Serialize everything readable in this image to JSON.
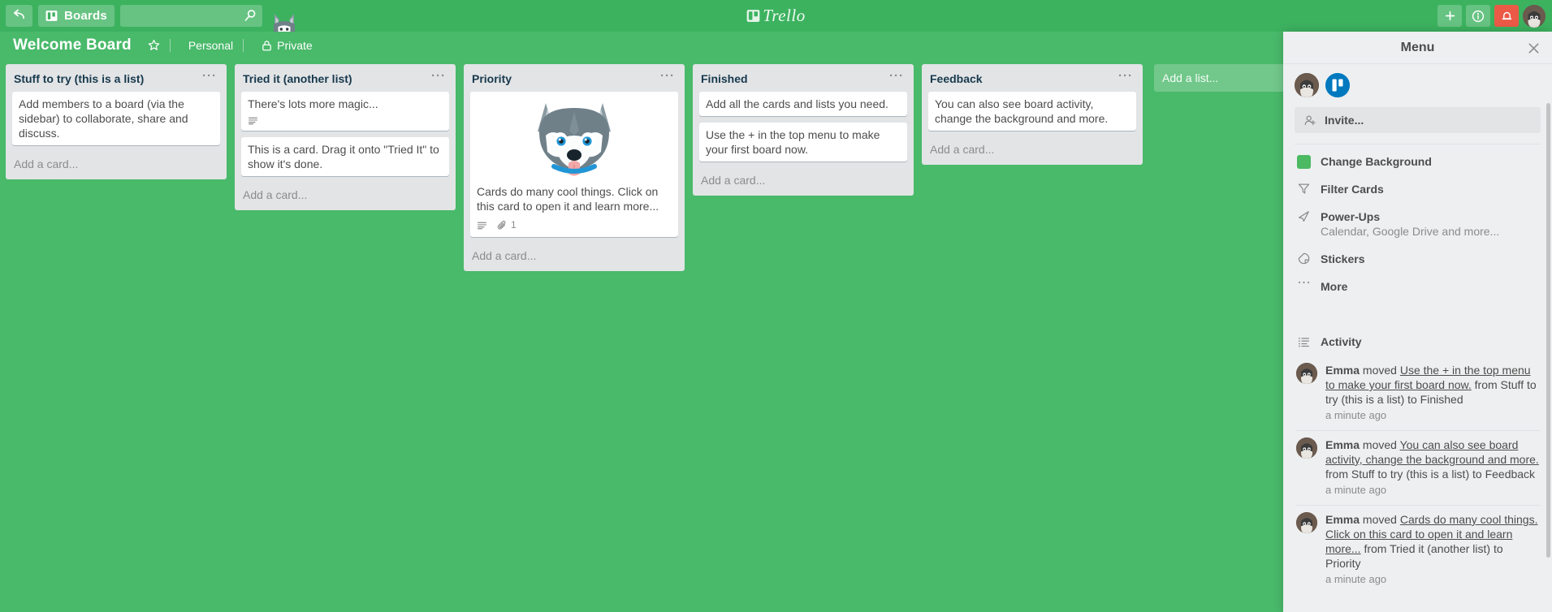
{
  "topbar": {
    "back_label": "back-arrow",
    "boards_label": "Boards",
    "search_placeholder": "",
    "search_value": "",
    "brand": "Trello",
    "add_label": "+",
    "info_label": "i",
    "notifications_label": "bell"
  },
  "board_header": {
    "title": "Welcome Board",
    "star": "☆",
    "team": "Personal",
    "visibility": "Private"
  },
  "lists": [
    {
      "title": "Stuff to try (this is a list)",
      "menu": "···",
      "add_card": "Add a card...",
      "cards": [
        {
          "text": "Add members to a board (via the sidebar) to collaborate, share and discuss.",
          "has_description": false,
          "attachments": ""
        }
      ]
    },
    {
      "title": "Tried it (another list)",
      "menu": "···",
      "add_card": "Add a card...",
      "cards": [
        {
          "text": "There's lots more magic...",
          "has_description": true,
          "attachments": ""
        },
        {
          "text": "This is a card. Drag it onto \"Tried It\" to show it's done.",
          "has_description": false,
          "attachments": ""
        }
      ]
    },
    {
      "title": "Priority",
      "menu": "···",
      "add_card": "Add a card...",
      "cards": [
        {
          "text": "Cards do many cool things. Click on this card to open it and learn more...",
          "has_description": true,
          "attachments": "1",
          "cover": "husky-dog-image"
        }
      ]
    },
    {
      "title": "Finished",
      "menu": "···",
      "add_card": "Add a card...",
      "cards": [
        {
          "text": "Add all the cards and lists you need.",
          "has_description": false,
          "attachments": ""
        },
        {
          "text": "Use the + in the top menu to make your first board now.",
          "has_description": false,
          "attachments": ""
        }
      ]
    },
    {
      "title": "Feedback",
      "menu": "···",
      "add_card": "Add a card...",
      "cards": [
        {
          "text": "You can also see board activity, change the background and more.",
          "has_description": false,
          "attachments": ""
        }
      ]
    }
  ],
  "add_list_label": "Add a list...",
  "sidebar": {
    "title": "Menu",
    "close": "×",
    "invite_label": "Invite...",
    "items": [
      {
        "label": "Change Background",
        "sub": "",
        "icon": "green-swatch-icon"
      },
      {
        "label": "Filter Cards",
        "sub": "",
        "icon": "filter-icon"
      },
      {
        "label": "Power-Ups",
        "sub": "Calendar, Google Drive and more...",
        "icon": "rocket-icon"
      },
      {
        "label": "Stickers",
        "sub": "",
        "icon": "sticker-icon"
      },
      {
        "label": "More",
        "sub": "",
        "icon": "ellipsis-icon"
      }
    ],
    "activity_label": "Activity",
    "activities": [
      {
        "user": "Emma",
        "verb": " moved ",
        "link": "Use the + in the top menu to make your first board now.",
        "tail": " from Stuff to try (this is a list) to Finished",
        "time": "a minute ago"
      },
      {
        "user": "Emma",
        "verb": " moved ",
        "link": "You can also see board activity, change the background and more.",
        "tail": " from Stuff to try (this is a list) to Feedback",
        "time": "a minute ago"
      },
      {
        "user": "Emma",
        "verb": " moved ",
        "link": "Cards do many cool things. Click on this card to open it and learn more...",
        "tail": " from Tried it (another list) to Priority",
        "time": "a minute ago"
      }
    ]
  },
  "colors": {
    "board_green": "#49b96a",
    "topbar_green": "#3cb25f",
    "list_grey": "#e2e4e6",
    "alert_red": "#eb5a46",
    "org_blue": "#0079bf"
  }
}
